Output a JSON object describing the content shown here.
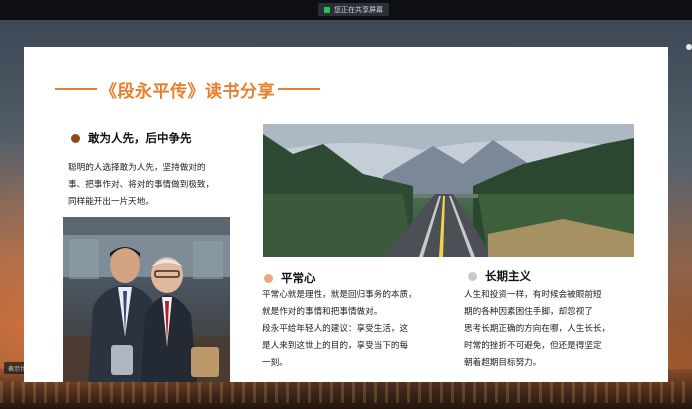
{
  "window": {
    "share_label": "您正在共享屏幕"
  },
  "overlay": {
    "bottom_left_label": "表示什么...",
    "bottom_left_arrow": "<"
  },
  "slide": {
    "title": "《段永平传》读书分享",
    "section1": {
      "heading": "敢为人先，后中争先",
      "bullet_color": "#8b4a1c",
      "lines": [
        "聪明的人选择敢为人先，坚持做对的",
        "事、把事作对、将对的事情做到极致，",
        "同样能开出一片天地。"
      ]
    },
    "section2": {
      "heading": "平常心",
      "bullet_color": "#e8a882",
      "lines": [
        "平常心就是理性，就是回归事务的本质，",
        "就是作对的事情和把事情做对。",
        "段永平给年轻人的建议：享受生活，这",
        "是人来到这世上的目的，享受当下的每",
        "一刻。"
      ]
    },
    "section3": {
      "heading": "长期主义",
      "bullet_color": "#c8c8c8",
      "lines": [
        "人生和投资一样，有时候会被眼前短",
        "期的各种因素困住手脚，却忽视了",
        "思考长期正确的方向在哪，人生长长，",
        "时常的挫折不可避免，但还是得坚定",
        "朝着超期目标努力。"
      ]
    }
  },
  "colors": {
    "accent": "#e6802f"
  }
}
